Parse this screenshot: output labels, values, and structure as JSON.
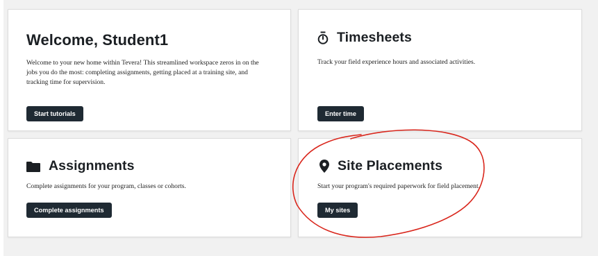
{
  "cards": {
    "welcome": {
      "title": "Welcome, Student1",
      "text": "Welcome to your new home within Tevera! This streamlined workspace zeros in on the jobs you do the most: completing assignments, getting placed at a training site, and tracking time for supervision.",
      "button": "Start tutorials"
    },
    "timesheets": {
      "title": "Timesheets",
      "icon": "stopwatch-icon",
      "text": "Track your field experience hours and associated activities.",
      "button": "Enter time"
    },
    "assignments": {
      "title": "Assignments",
      "icon": "folder-icon",
      "text": "Complete assignments for your program, classes or cohorts.",
      "button": "Complete assignments"
    },
    "site_placements": {
      "title": "Site Placements",
      "icon": "map-pin-icon",
      "text": "Start your program's required paperwork for field placement.",
      "button": "My sites"
    }
  },
  "colors": {
    "button_bg": "#1f2a33",
    "annotation": "#d9261c",
    "background": "#f1f1f1"
  }
}
